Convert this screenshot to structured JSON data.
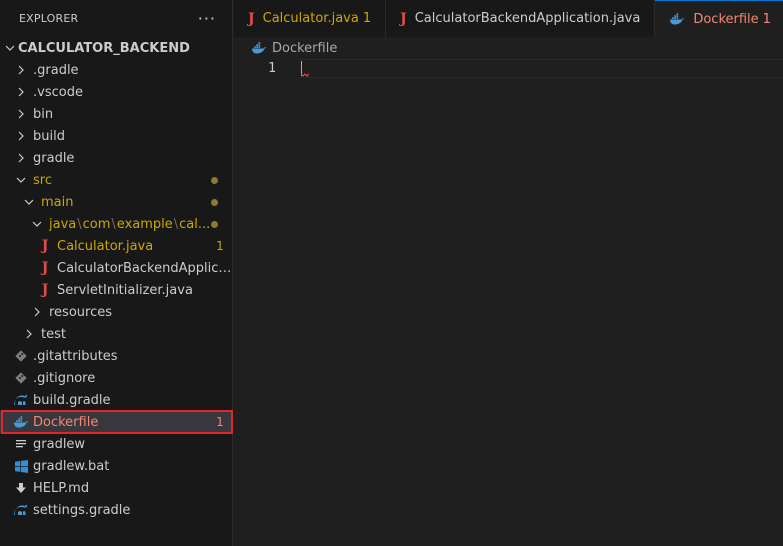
{
  "explorer": {
    "title": "EXPLORER",
    "more": "···",
    "root": "CALCULATOR_BACKEND",
    "tree": [
      {
        "label": ".gradle",
        "kind": "folder",
        "indent": 0
      },
      {
        "label": ".vscode",
        "kind": "folder",
        "indent": 0
      },
      {
        "label": "bin",
        "kind": "folder",
        "indent": 0
      },
      {
        "label": "build",
        "kind": "folder",
        "indent": 0
      },
      {
        "label": "gradle",
        "kind": "folder",
        "indent": 0
      },
      {
        "label": "src",
        "kind": "folder-open",
        "indent": 0,
        "status": "modified"
      },
      {
        "label": "main",
        "kind": "folder-open",
        "indent": 1,
        "status": "modified"
      },
      {
        "label": "java\\com\\example\\cal...",
        "kind": "folder-open",
        "indent": 2,
        "status": "modified"
      },
      {
        "label": "Calculator.java",
        "kind": "java",
        "indent": 3,
        "badge": "1",
        "status": "modified"
      },
      {
        "label": "CalculatorBackendApplicatio...",
        "kind": "java",
        "indent": 3
      },
      {
        "label": "ServletInitializer.java",
        "kind": "java",
        "indent": 3
      },
      {
        "label": "resources",
        "kind": "folder",
        "indent": 2
      },
      {
        "label": "test",
        "kind": "folder",
        "indent": 1
      },
      {
        "label": ".gitattributes",
        "kind": "git",
        "indent": 0
      },
      {
        "label": ".gitignore",
        "kind": "git",
        "indent": 0
      },
      {
        "label": "build.gradle",
        "kind": "gradle",
        "indent": 0
      },
      {
        "label": "Dockerfile",
        "kind": "docker",
        "indent": 0,
        "badge": "1",
        "status": "selected"
      },
      {
        "label": "gradlew",
        "kind": "lines",
        "indent": 0
      },
      {
        "label": "gradlew.bat",
        "kind": "windows",
        "indent": 0
      },
      {
        "label": "HELP.md",
        "kind": "markdown",
        "indent": 0
      },
      {
        "label": "settings.gradle",
        "kind": "gradle",
        "indent": 0
      }
    ]
  },
  "tabs": [
    {
      "label": "Calculator.java",
      "num": "1",
      "icon": "java-icon",
      "color": "#cca700",
      "active": false
    },
    {
      "label": "CalculatorBackendApplication.java",
      "num": "",
      "icon": "java-icon",
      "color": "#cccccc",
      "active": false
    },
    {
      "label": "Dockerfile",
      "num": "1",
      "icon": "docker-icon",
      "color": "#f48771",
      "active": true
    }
  ],
  "breadcrumb": {
    "file": "Dockerfile"
  },
  "editor": {
    "line_number": "1"
  },
  "colors": {
    "modified": "#cca700",
    "error": "#f14c4c",
    "java_icon": "#e04b4b",
    "docker_icon": "#4a9bd4",
    "gradle_icon": "#4a9bd4",
    "git_icon": "#7e7e7e",
    "highlight_box": "#e2252b"
  }
}
